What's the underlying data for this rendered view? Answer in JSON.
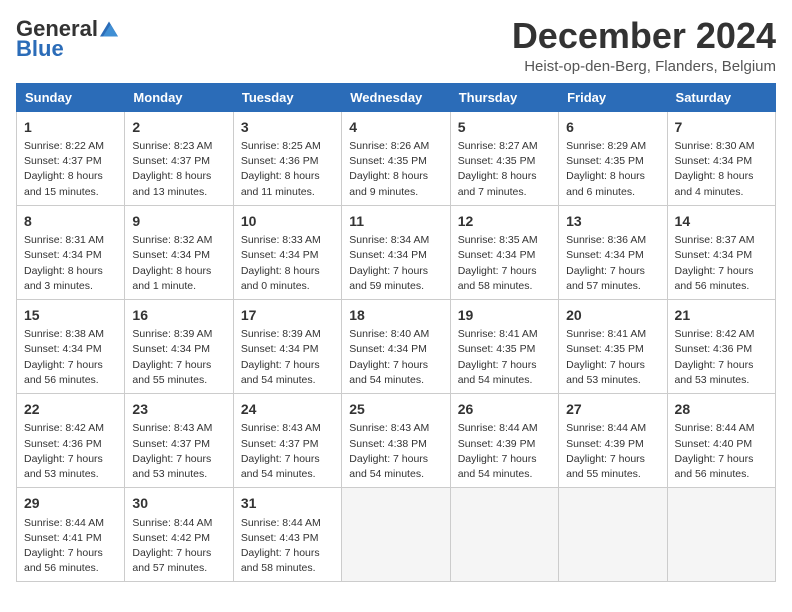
{
  "header": {
    "logo_general": "General",
    "logo_blue": "Blue",
    "title": "December 2024",
    "subtitle": "Heist-op-den-Berg, Flanders, Belgium"
  },
  "days_of_week": [
    "Sunday",
    "Monday",
    "Tuesday",
    "Wednesday",
    "Thursday",
    "Friday",
    "Saturday"
  ],
  "weeks": [
    [
      {
        "day": "1",
        "info": "Sunrise: 8:22 AM\nSunset: 4:37 PM\nDaylight: 8 hours and 15 minutes."
      },
      {
        "day": "2",
        "info": "Sunrise: 8:23 AM\nSunset: 4:37 PM\nDaylight: 8 hours and 13 minutes."
      },
      {
        "day": "3",
        "info": "Sunrise: 8:25 AM\nSunset: 4:36 PM\nDaylight: 8 hours and 11 minutes."
      },
      {
        "day": "4",
        "info": "Sunrise: 8:26 AM\nSunset: 4:35 PM\nDaylight: 8 hours and 9 minutes."
      },
      {
        "day": "5",
        "info": "Sunrise: 8:27 AM\nSunset: 4:35 PM\nDaylight: 8 hours and 7 minutes."
      },
      {
        "day": "6",
        "info": "Sunrise: 8:29 AM\nSunset: 4:35 PM\nDaylight: 8 hours and 6 minutes."
      },
      {
        "day": "7",
        "info": "Sunrise: 8:30 AM\nSunset: 4:34 PM\nDaylight: 8 hours and 4 minutes."
      }
    ],
    [
      {
        "day": "8",
        "info": "Sunrise: 8:31 AM\nSunset: 4:34 PM\nDaylight: 8 hours and 3 minutes."
      },
      {
        "day": "9",
        "info": "Sunrise: 8:32 AM\nSunset: 4:34 PM\nDaylight: 8 hours and 1 minute."
      },
      {
        "day": "10",
        "info": "Sunrise: 8:33 AM\nSunset: 4:34 PM\nDaylight: 8 hours and 0 minutes."
      },
      {
        "day": "11",
        "info": "Sunrise: 8:34 AM\nSunset: 4:34 PM\nDaylight: 7 hours and 59 minutes."
      },
      {
        "day": "12",
        "info": "Sunrise: 8:35 AM\nSunset: 4:34 PM\nDaylight: 7 hours and 58 minutes."
      },
      {
        "day": "13",
        "info": "Sunrise: 8:36 AM\nSunset: 4:34 PM\nDaylight: 7 hours and 57 minutes."
      },
      {
        "day": "14",
        "info": "Sunrise: 8:37 AM\nSunset: 4:34 PM\nDaylight: 7 hours and 56 minutes."
      }
    ],
    [
      {
        "day": "15",
        "info": "Sunrise: 8:38 AM\nSunset: 4:34 PM\nDaylight: 7 hours and 56 minutes."
      },
      {
        "day": "16",
        "info": "Sunrise: 8:39 AM\nSunset: 4:34 PM\nDaylight: 7 hours and 55 minutes."
      },
      {
        "day": "17",
        "info": "Sunrise: 8:39 AM\nSunset: 4:34 PM\nDaylight: 7 hours and 54 minutes."
      },
      {
        "day": "18",
        "info": "Sunrise: 8:40 AM\nSunset: 4:34 PM\nDaylight: 7 hours and 54 minutes."
      },
      {
        "day": "19",
        "info": "Sunrise: 8:41 AM\nSunset: 4:35 PM\nDaylight: 7 hours and 54 minutes."
      },
      {
        "day": "20",
        "info": "Sunrise: 8:41 AM\nSunset: 4:35 PM\nDaylight: 7 hours and 53 minutes."
      },
      {
        "day": "21",
        "info": "Sunrise: 8:42 AM\nSunset: 4:36 PM\nDaylight: 7 hours and 53 minutes."
      }
    ],
    [
      {
        "day": "22",
        "info": "Sunrise: 8:42 AM\nSunset: 4:36 PM\nDaylight: 7 hours and 53 minutes."
      },
      {
        "day": "23",
        "info": "Sunrise: 8:43 AM\nSunset: 4:37 PM\nDaylight: 7 hours and 53 minutes."
      },
      {
        "day": "24",
        "info": "Sunrise: 8:43 AM\nSunset: 4:37 PM\nDaylight: 7 hours and 54 minutes."
      },
      {
        "day": "25",
        "info": "Sunrise: 8:43 AM\nSunset: 4:38 PM\nDaylight: 7 hours and 54 minutes."
      },
      {
        "day": "26",
        "info": "Sunrise: 8:44 AM\nSunset: 4:39 PM\nDaylight: 7 hours and 54 minutes."
      },
      {
        "day": "27",
        "info": "Sunrise: 8:44 AM\nSunset: 4:39 PM\nDaylight: 7 hours and 55 minutes."
      },
      {
        "day": "28",
        "info": "Sunrise: 8:44 AM\nSunset: 4:40 PM\nDaylight: 7 hours and 56 minutes."
      }
    ],
    [
      {
        "day": "29",
        "info": "Sunrise: 8:44 AM\nSunset: 4:41 PM\nDaylight: 7 hours and 56 minutes."
      },
      {
        "day": "30",
        "info": "Sunrise: 8:44 AM\nSunset: 4:42 PM\nDaylight: 7 hours and 57 minutes."
      },
      {
        "day": "31",
        "info": "Sunrise: 8:44 AM\nSunset: 4:43 PM\nDaylight: 7 hours and 58 minutes."
      },
      {
        "day": "",
        "info": ""
      },
      {
        "day": "",
        "info": ""
      },
      {
        "day": "",
        "info": ""
      },
      {
        "day": "",
        "info": ""
      }
    ]
  ]
}
